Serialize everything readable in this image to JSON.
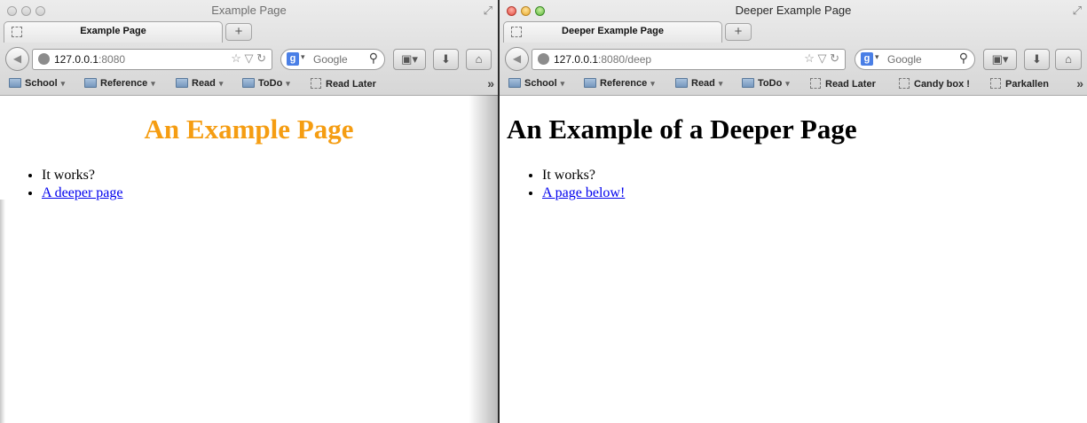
{
  "left_window": {
    "title": "Example Page",
    "tab_label": "Example Page",
    "new_tab_label": "+",
    "url_host": "127.0.0.1",
    "url_rest": ":8080",
    "search_placeholder": "Google",
    "bookmarks": [
      {
        "label": "School",
        "type": "folder"
      },
      {
        "label": "Reference",
        "type": "folder"
      },
      {
        "label": "Read",
        "type": "folder"
      },
      {
        "label": "ToDo",
        "type": "folder"
      },
      {
        "label": "Read Later",
        "type": "page"
      }
    ],
    "overflow": "»",
    "heading": "An Example Page",
    "heading_color": "#f59d12",
    "list_text": "It works?",
    "list_link": "A deeper page"
  },
  "right_window": {
    "title": "Deeper Example Page",
    "tab_label": "Deeper Example Page",
    "new_tab_label": "+",
    "url_host": "127.0.0.1",
    "url_rest": ":8080/deep",
    "search_placeholder": "Google",
    "bookmarks": [
      {
        "label": "School",
        "type": "folder"
      },
      {
        "label": "Reference",
        "type": "folder"
      },
      {
        "label": "Read",
        "type": "folder"
      },
      {
        "label": "ToDo",
        "type": "folder"
      },
      {
        "label": "Read Later",
        "type": "page"
      },
      {
        "label": "Candy box !",
        "type": "page"
      },
      {
        "label": "Parkallen",
        "type": "page"
      }
    ],
    "overflow": "»",
    "heading": "An Example of a Deeper Page",
    "list_text": "It works?",
    "list_link": "A page below!"
  },
  "icons": {
    "search_engine_badge": "g",
    "back": "◀",
    "star": "☆",
    "dropdown": "▽",
    "reload": "↻",
    "magnifier": "🔍",
    "download": "⬇",
    "home": "⌂",
    "fullscreen": "⤢"
  }
}
